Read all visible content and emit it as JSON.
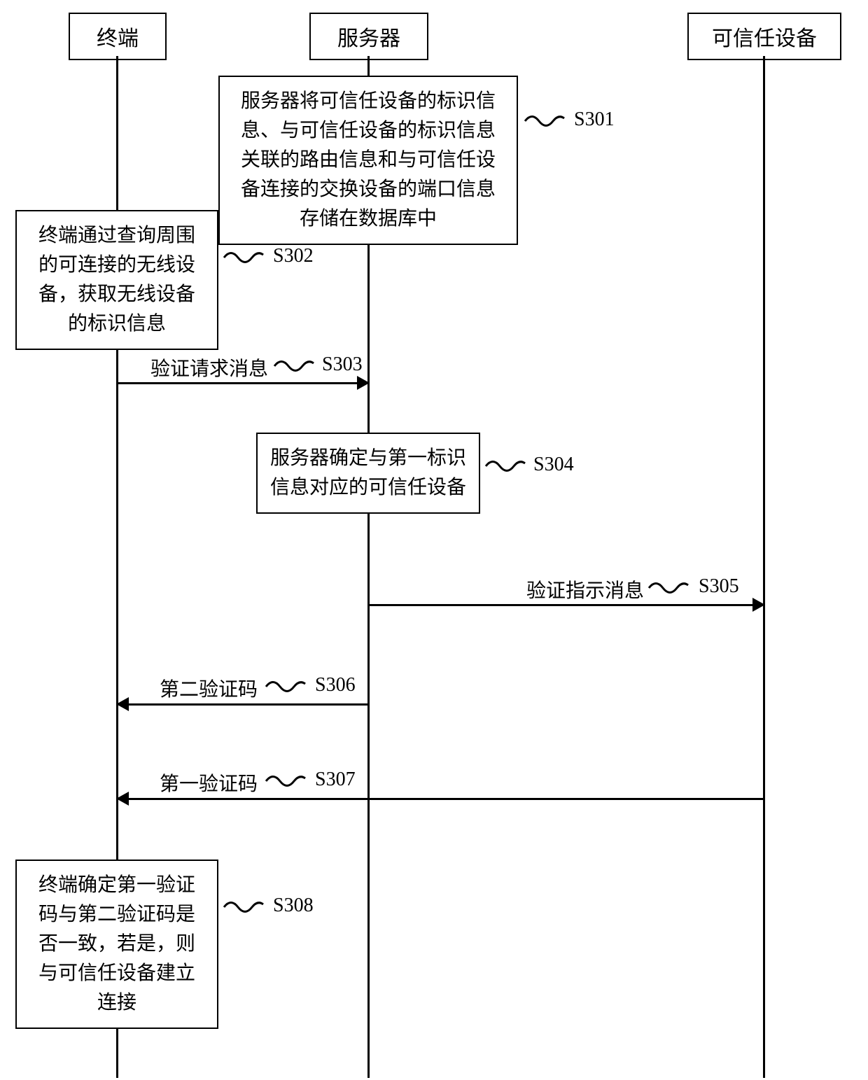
{
  "actors": {
    "terminal": "终端",
    "server": "服务器",
    "trusted_device": "可信任设备"
  },
  "steps": {
    "s301": {
      "id": "S301",
      "text": "服务器将可信任设备的标识信息、与可信任设备的标识信息关联的路由信息和与可信任设备连接的交换设备的端口信息存储在数据库中"
    },
    "s302": {
      "id": "S302",
      "text": "终端通过查询周围的可连接的无线设备，获取无线设备的标识信息"
    },
    "s303": {
      "id": "S303",
      "text": "验证请求消息"
    },
    "s304": {
      "id": "S304",
      "text": "服务器确定与第一标识信息对应的可信任设备"
    },
    "s305": {
      "id": "S305",
      "text": "验证指示消息"
    },
    "s306": {
      "id": "S306",
      "text": "第二验证码"
    },
    "s307": {
      "id": "S307",
      "text": "第一验证码"
    },
    "s308": {
      "id": "S308",
      "text": "终端确定第一验证码与第二验证码是否一致，若是，则与可信任设备建立连接"
    }
  }
}
